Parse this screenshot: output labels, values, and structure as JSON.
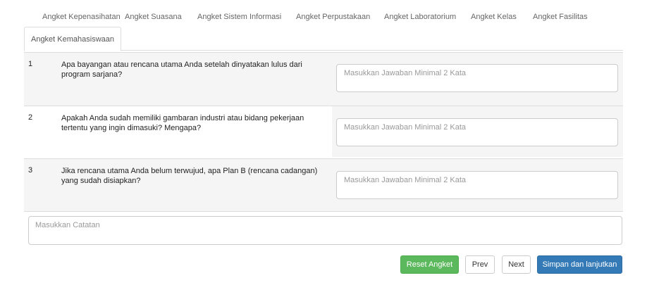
{
  "tabs": {
    "items": [
      {
        "label": "Angket Kepenasihatan"
      },
      {
        "label": "Angket Suasana"
      },
      {
        "label": "Angket Sistem Informasi"
      },
      {
        "label": "Angket Perpustakaan"
      },
      {
        "label": "Angket Laboratorium"
      },
      {
        "label": "Angket Kelas"
      },
      {
        "label": "Angket Fasilitas"
      }
    ],
    "active": {
      "label": "Angket Kemahasiswaan"
    }
  },
  "questions": [
    {
      "number": "1",
      "text": "Apa bayangan atau rencana utama Anda setelah dinyatakan lulus dari program sarjana?",
      "answer_placeholder": "Masukkan Jawaban Minimal 2 Kata",
      "answer_value": ""
    },
    {
      "number": "2",
      "text": "Apakah Anda sudah memiliki gambaran industri atau bidang pekerjaan tertentu yang ingin dimasuki? Mengapa?",
      "answer_placeholder": "Masukkan Jawaban Minimal 2 Kata",
      "answer_value": ""
    },
    {
      "number": "3",
      "text": "Jika rencana utama Anda belum terwujud, apa Plan B (rencana cadangan) yang sudah disiapkan?",
      "answer_placeholder": "Masukkan Jawaban Minimal 2 Kata",
      "answer_value": ""
    }
  ],
  "notes": {
    "placeholder": "Masukkan Catatan",
    "value": ""
  },
  "buttons": {
    "reset": "Reset Angket",
    "prev": "Prev",
    "next": "Next",
    "save": "Simpan dan lanjutkan"
  },
  "colors": {
    "success": "#5cb85c",
    "primary": "#337ab7",
    "row_alt": "#f5f5f5",
    "border": "#dddddd"
  }
}
